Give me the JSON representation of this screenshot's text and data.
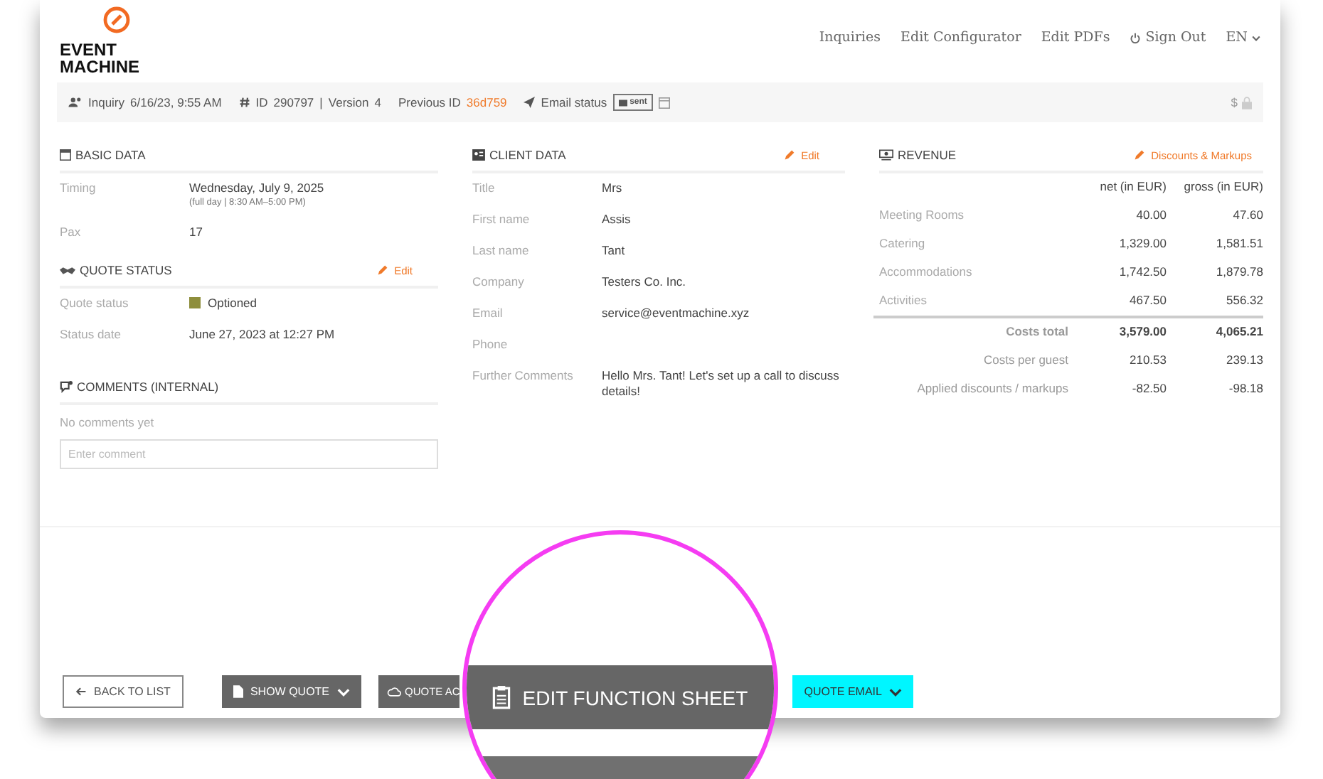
{
  "logo": {
    "lines": [
      "EVENT",
      "MACHINE"
    ]
  },
  "nav": [
    {
      "label": "Inquiries",
      "kind": "link"
    },
    {
      "label": "Edit Configurator",
      "kind": "link"
    },
    {
      "label": "Edit PDFs",
      "kind": "link"
    },
    {
      "label": "Sign Out",
      "kind": "signout"
    },
    {
      "label": "EN",
      "kind": "dropdown"
    }
  ],
  "info_bar": {
    "inquiry_label": "Inquiry",
    "inquiry_date": "6/16/23, 9:55 AM",
    "id_label": "ID",
    "id": "290797",
    "separator": "|",
    "version_label": "Version",
    "version": "4",
    "previous_id_label": "Previous ID",
    "previous_id": "36d759",
    "email_status_label": "Email status",
    "email_status": "sent",
    "currency": "$"
  },
  "basic_data": {
    "title": "BASIC DATA",
    "rows": [
      {
        "label": "Timing",
        "value": "Wednesday, July 9, 2025",
        "note": "(full day | 8:30 AM–5:00 PM)"
      },
      {
        "label": "Pax",
        "value": "17"
      }
    ]
  },
  "quote_status": {
    "title": "QUOTE STATUS",
    "action": "Edit",
    "rows": [
      {
        "label": "Quote status",
        "value": "Optioned",
        "color": "#8e8e3c"
      },
      {
        "label": "Status date",
        "value": "June 27, 2023 at 12:27 PM"
      }
    ]
  },
  "comments": {
    "title": "COMMENTS (INTERNAL)",
    "empty_text": "No comments yet",
    "placeholder": "Enter comment"
  },
  "client_data": {
    "title": "CLIENT DATA",
    "action": "Edit",
    "rows": [
      {
        "label": "Title",
        "value": "Mrs"
      },
      {
        "label": "First name",
        "value": "Assis"
      },
      {
        "label": "Last name",
        "value": "Tant"
      },
      {
        "label": "Company",
        "value": "Testers Co. Inc."
      },
      {
        "label": "Email",
        "value": "service@eventmachine.xyz"
      },
      {
        "label": "Phone"
      },
      {
        "label": "Further Comments",
        "value": "Hello Mrs. Tant! Let's set up a call to discuss details!"
      }
    ]
  },
  "revenue": {
    "title": "REVENUE",
    "action": "Discounts & Markups",
    "columns": [
      "net (in EUR)",
      "gross (in EUR)"
    ],
    "rows": [
      {
        "label": "Meeting Rooms",
        "net": "40.00",
        "gross": "47.60"
      },
      {
        "label": "Catering",
        "net": "1,329.00",
        "gross": "1,581.51"
      },
      {
        "label": "Accommodations",
        "net": "1,742.50",
        "gross": "1,879.78"
      },
      {
        "label": "Activities",
        "net": "467.50",
        "gross": "556.32"
      }
    ],
    "totals": [
      {
        "label": "Costs total",
        "net": "3,579.00",
        "gross": "4,065.21",
        "kind": "bold"
      },
      {
        "label": "Costs per guest",
        "net": "210.53",
        "gross": "239.13",
        "kind": "plain"
      },
      {
        "label": "Applied discounts / markups",
        "net": "-82.50",
        "gross": "-98.18",
        "kind": "plain"
      }
    ]
  },
  "buttons": [
    {
      "label": "BACK TO LIST",
      "kind": "outline"
    },
    {
      "label": "SHOW QUOTE",
      "kind": "quote"
    },
    {
      "label": "QUOTE AC",
      "kind": "actions"
    },
    {
      "label": "QUOTE EMAIL",
      "kind": "cyan"
    }
  ],
  "magnifier": {
    "button_label": "EDIT FUNCTION SHEET"
  }
}
